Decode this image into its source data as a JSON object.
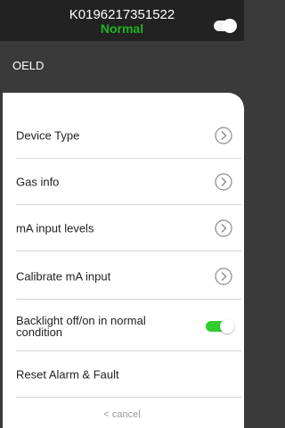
{
  "header": {
    "device_id": "K0196217351522",
    "status": "Normal",
    "status_color": "#1fb31f"
  },
  "subheader": {
    "title": "OELD"
  },
  "menu": {
    "items": [
      {
        "label": "Device Type",
        "icon": "chevron-right-circle-icon"
      },
      {
        "label": "Gas info",
        "icon": "chevron-right-circle-icon"
      },
      {
        "label": "mA input levels",
        "icon": "chevron-right-circle-icon"
      },
      {
        "label": "Calibrate mA input",
        "icon": "chevron-right-circle-icon"
      },
      {
        "label": "Backlight off/on in normal condition",
        "toggle": true,
        "toggle_color": "#2dce2d"
      },
      {
        "label": "Reset Alarm & Fault"
      }
    ]
  },
  "footer": {
    "cancel_label": "< cancel"
  }
}
